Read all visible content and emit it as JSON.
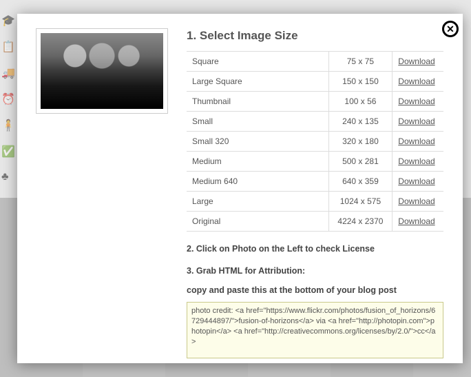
{
  "heading1": "1. Select Image Size",
  "sizes": [
    {
      "name": "Square",
      "dims": "75 x 75",
      "link": "Download"
    },
    {
      "name": "Large Square",
      "dims": "150 x 150",
      "link": "Download"
    },
    {
      "name": "Thumbnail",
      "dims": "100 x 56",
      "link": "Download"
    },
    {
      "name": "Small",
      "dims": "240 x 135",
      "link": "Download"
    },
    {
      "name": "Small 320",
      "dims": "320 x 180",
      "link": "Download"
    },
    {
      "name": "Medium",
      "dims": "500 x 281",
      "link": "Download"
    },
    {
      "name": "Medium 640",
      "dims": "640 x 359",
      "link": "Download"
    },
    {
      "name": "Large",
      "dims": "1024 x 575",
      "link": "Download"
    },
    {
      "name": "Original",
      "dims": "4224 x 2370",
      "link": "Download"
    }
  ],
  "step2": "2. Click on Photo on the Left to check License",
  "step3": "3. Grab HTML for Attribution:",
  "step3sub": "copy and paste this at the bottom of your blog post",
  "attribution_html": "photo credit: <a href=\"https://www.flickr.com/photos/fusion_of_horizons/6729444897/\">fusion-of-horizons</a> via <a href=\"http://photopin.com\">photopin</a> <a href=\"http://creativecommons.org/licenses/by/2.0/\">cc</a>",
  "close_label": "✕"
}
